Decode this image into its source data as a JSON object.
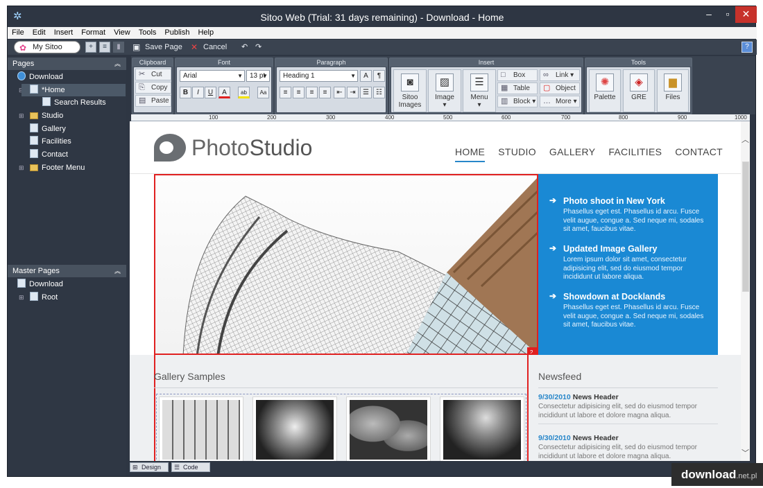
{
  "window": {
    "title": "Sitoo Web (Trial: 31 days remaining) - Download - Home"
  },
  "menubar": {
    "items": [
      "File",
      "Edit",
      "Insert",
      "Format",
      "View",
      "Tools",
      "Publish",
      "Help"
    ]
  },
  "toolbar": {
    "site_selector": "My Sitoo",
    "save_label": "Save Page",
    "cancel_label": "Cancel"
  },
  "ribbon": {
    "clipboard": {
      "title": "Clipboard",
      "cut": "Cut",
      "copy": "Copy",
      "paste": "Paste"
    },
    "font": {
      "title": "Font",
      "family": "Arial",
      "size": "13 pt"
    },
    "paragraph": {
      "title": "Paragraph",
      "style": "Heading 1"
    },
    "insert": {
      "title": "Insert",
      "sitoo_images": "Sitoo Images",
      "image": "Image",
      "menu": "Menu",
      "box": "Box",
      "table": "Table",
      "block": "Block",
      "link": "Link",
      "object": "Object",
      "more": "More"
    },
    "tools": {
      "title": "Tools",
      "palette": "Palette",
      "gre": "GRE",
      "files": "Files"
    }
  },
  "ruler": {
    "labels": [
      "100",
      "200",
      "300",
      "400",
      "500",
      "600",
      "700",
      "800",
      "900",
      "1000"
    ]
  },
  "sidebar": {
    "pages_title": "Pages",
    "pages": [
      {
        "label": "Download"
      },
      {
        "label": "*Home"
      },
      {
        "label": "Search Results"
      },
      {
        "label": "Studio"
      },
      {
        "label": "Gallery"
      },
      {
        "label": "Facilities"
      },
      {
        "label": "Contact"
      },
      {
        "label": "Footer Menu"
      }
    ],
    "master_title": "Master Pages",
    "master": [
      {
        "label": "Download"
      },
      {
        "label": "Root"
      }
    ]
  },
  "site": {
    "logo_text": "Photo",
    "logo_text2": "Studio",
    "nav": [
      "HOME",
      "STUDIO",
      "GALLERY",
      "FACILITIES",
      "CONTACT"
    ],
    "hero_badge": "2",
    "news": [
      {
        "title": "Photo shoot in New York",
        "text": "Phasellus eget est. Phasellus id arcu. Fusce velit augue, congue a. Sed neque mi, sodales sit amet, faucibus vitae."
      },
      {
        "title": "Updated Image Gallery",
        "text": "Lorem ipsum dolor sit amet, consectetur adipisicing elit, sed do eiusmod tempor incididunt ut labore aliqua."
      },
      {
        "title": "Showdown at Docklands",
        "text": "Phasellus eget est. Phasellus id arcu. Fusce velit augue, congue a. Sed neque mi, sodales sit amet, faucibus vitae."
      }
    ],
    "gallery_title": "Gallery Samples",
    "newsfeed_title": "Newsfeed",
    "newsfeed": [
      {
        "date": "9/30/2010",
        "header": "News Header",
        "text": "Consectetur adipisicing elit, sed do eiusmod tempor incididunt ut labore et dolore magna aliqua."
      },
      {
        "date": "9/30/2010",
        "header": "News Header",
        "text": "Consectetur adipisicing elit, sed do eiusmod tempor incididunt ut labore et dolore magna aliqua."
      }
    ]
  },
  "statusbar": {
    "design": "Design",
    "code": "Code"
  },
  "watermark": {
    "text": "download",
    "suffix": ".net.pl"
  }
}
